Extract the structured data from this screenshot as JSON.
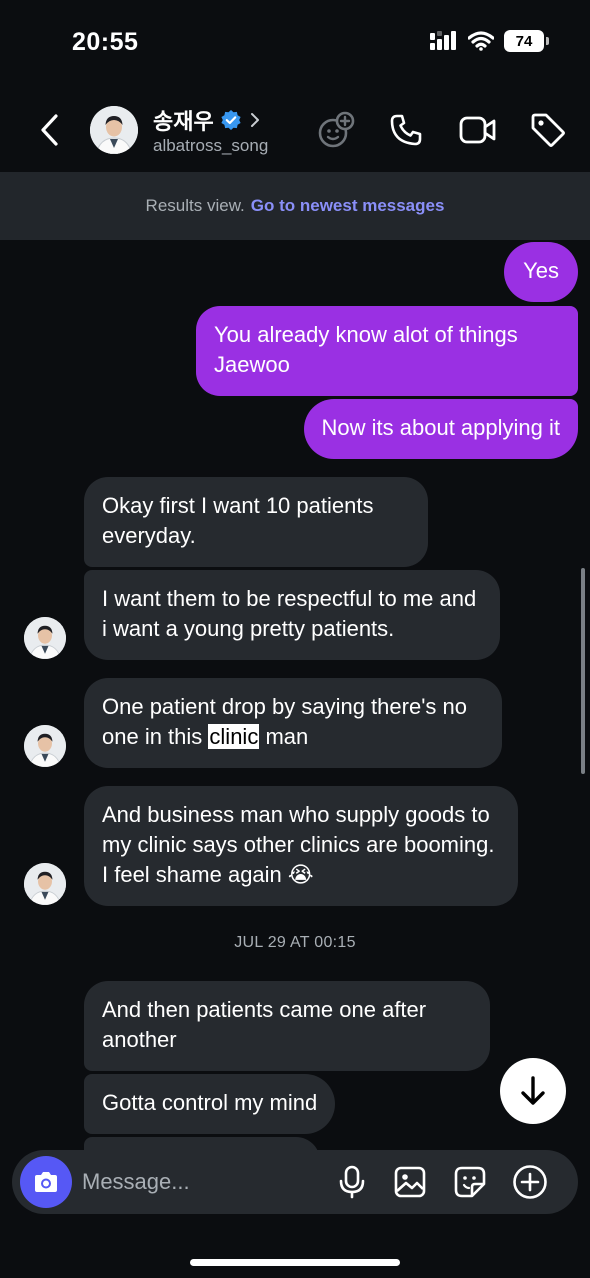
{
  "status_bar": {
    "time": "20:55",
    "battery": "74"
  },
  "header": {
    "name": "송재우",
    "username": "albatross_song",
    "verified": true,
    "icons": [
      "back-arrow-icon",
      "effects-icon",
      "phone-icon",
      "video-icon",
      "tag-icon"
    ]
  },
  "banner": {
    "text": "Results view.",
    "link": "Go to newest messages"
  },
  "messages": [
    {
      "dir": "out",
      "text": "Yes"
    },
    {
      "dir": "out",
      "text": "You already know alot of things Jaewoo"
    },
    {
      "dir": "out",
      "text": "Now its about applying it"
    },
    {
      "dir": "in",
      "text": "Okay first I want 10 patients everyday."
    },
    {
      "dir": "in",
      "text": "I want them to be respectful to me and i want a young pretty patients."
    },
    {
      "dir": "in",
      "text_before": "One patient drop by saying there's no one in this",
      "highlight": "clinic",
      "text_after": "man"
    },
    {
      "dir": "in",
      "text": "And business man who supply goods to my clinic says other clinics are booming. I feel shame again",
      "emoji": "😭"
    },
    {
      "dir": "in",
      "text": "And then patients came one after another"
    },
    {
      "dir": "in",
      "text": "Gotta control my mind"
    }
  ],
  "timestamp": "JUL 29 AT 00:15",
  "composer": {
    "placeholder": "Message...",
    "icons": [
      "camera-icon",
      "microphone-icon",
      "gallery-icon",
      "sticker-icon",
      "plus-icon"
    ]
  },
  "colors": {
    "background": "#0b0d10",
    "outgoing_bubble": "#9a30e3",
    "incoming_bubble": "#262a2f",
    "link": "#8a8ff8",
    "camera_button": "#5658f5",
    "verified": "#3897f0"
  }
}
